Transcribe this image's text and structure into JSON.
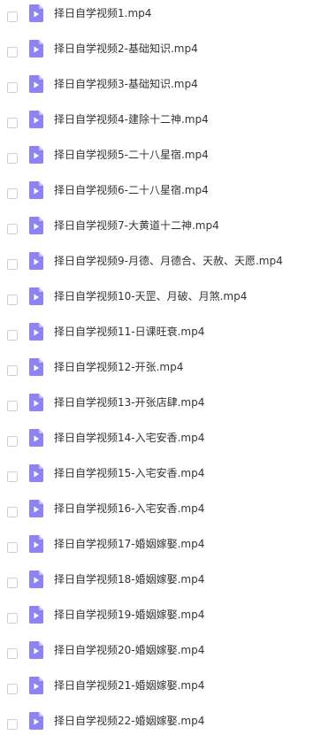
{
  "icon": "video-file-icon",
  "colors": {
    "icon_fill": "#8d83f5",
    "icon_fold": "#c3bdfa",
    "icon_play": "#ffffff",
    "checkbox_border": "#c9ced6",
    "text": "#333333"
  },
  "files": [
    {
      "name": "择日自学视频1.mp4",
      "checked": false
    },
    {
      "name": "择日自学视频2-基础知识.mp4",
      "checked": false
    },
    {
      "name": "择日自学视频3-基础知识.mp4",
      "checked": false
    },
    {
      "name": "择日自学视频4-建除十二神.mp4",
      "checked": false
    },
    {
      "name": "择日自学视频5-二十八星宿.mp4",
      "checked": false
    },
    {
      "name": "择日自学视频6-二十八星宿.mp4",
      "checked": false
    },
    {
      "name": "择日自学视频7-大黄道十二神.mp4",
      "checked": false
    },
    {
      "name": "择日自学视频9-月德、月德合、天赦、天愿.mp4",
      "checked": false
    },
    {
      "name": "择日自学视频10-天罡、月破、月煞.mp4",
      "checked": false
    },
    {
      "name": "择日自学视频11-日课旺衰.mp4",
      "checked": false
    },
    {
      "name": "择日自学视频12-开张.mp4",
      "checked": false
    },
    {
      "name": "择日自学视频13-开张店肆.mp4",
      "checked": false
    },
    {
      "name": "择日自学视频14-入宅安香.mp4",
      "checked": false
    },
    {
      "name": "择日自学视频15-入宅安香.mp4",
      "checked": false
    },
    {
      "name": "择日自学视频16-入宅安香.mp4",
      "checked": false
    },
    {
      "name": "择日自学视频17-婚姻嫁娶.mp4",
      "checked": false
    },
    {
      "name": "择日自学视频18-婚姻嫁娶.mp4",
      "checked": false
    },
    {
      "name": "择日自学视频19-婚姻嫁娶.mp4",
      "checked": false
    },
    {
      "name": "择日自学视频20-婚姻嫁娶.mp4",
      "checked": false
    },
    {
      "name": "择日自学视频21-婚姻嫁娶.mp4",
      "checked": false
    },
    {
      "name": "择日自学视频22-婚姻嫁娶.mp4",
      "checked": false
    }
  ]
}
